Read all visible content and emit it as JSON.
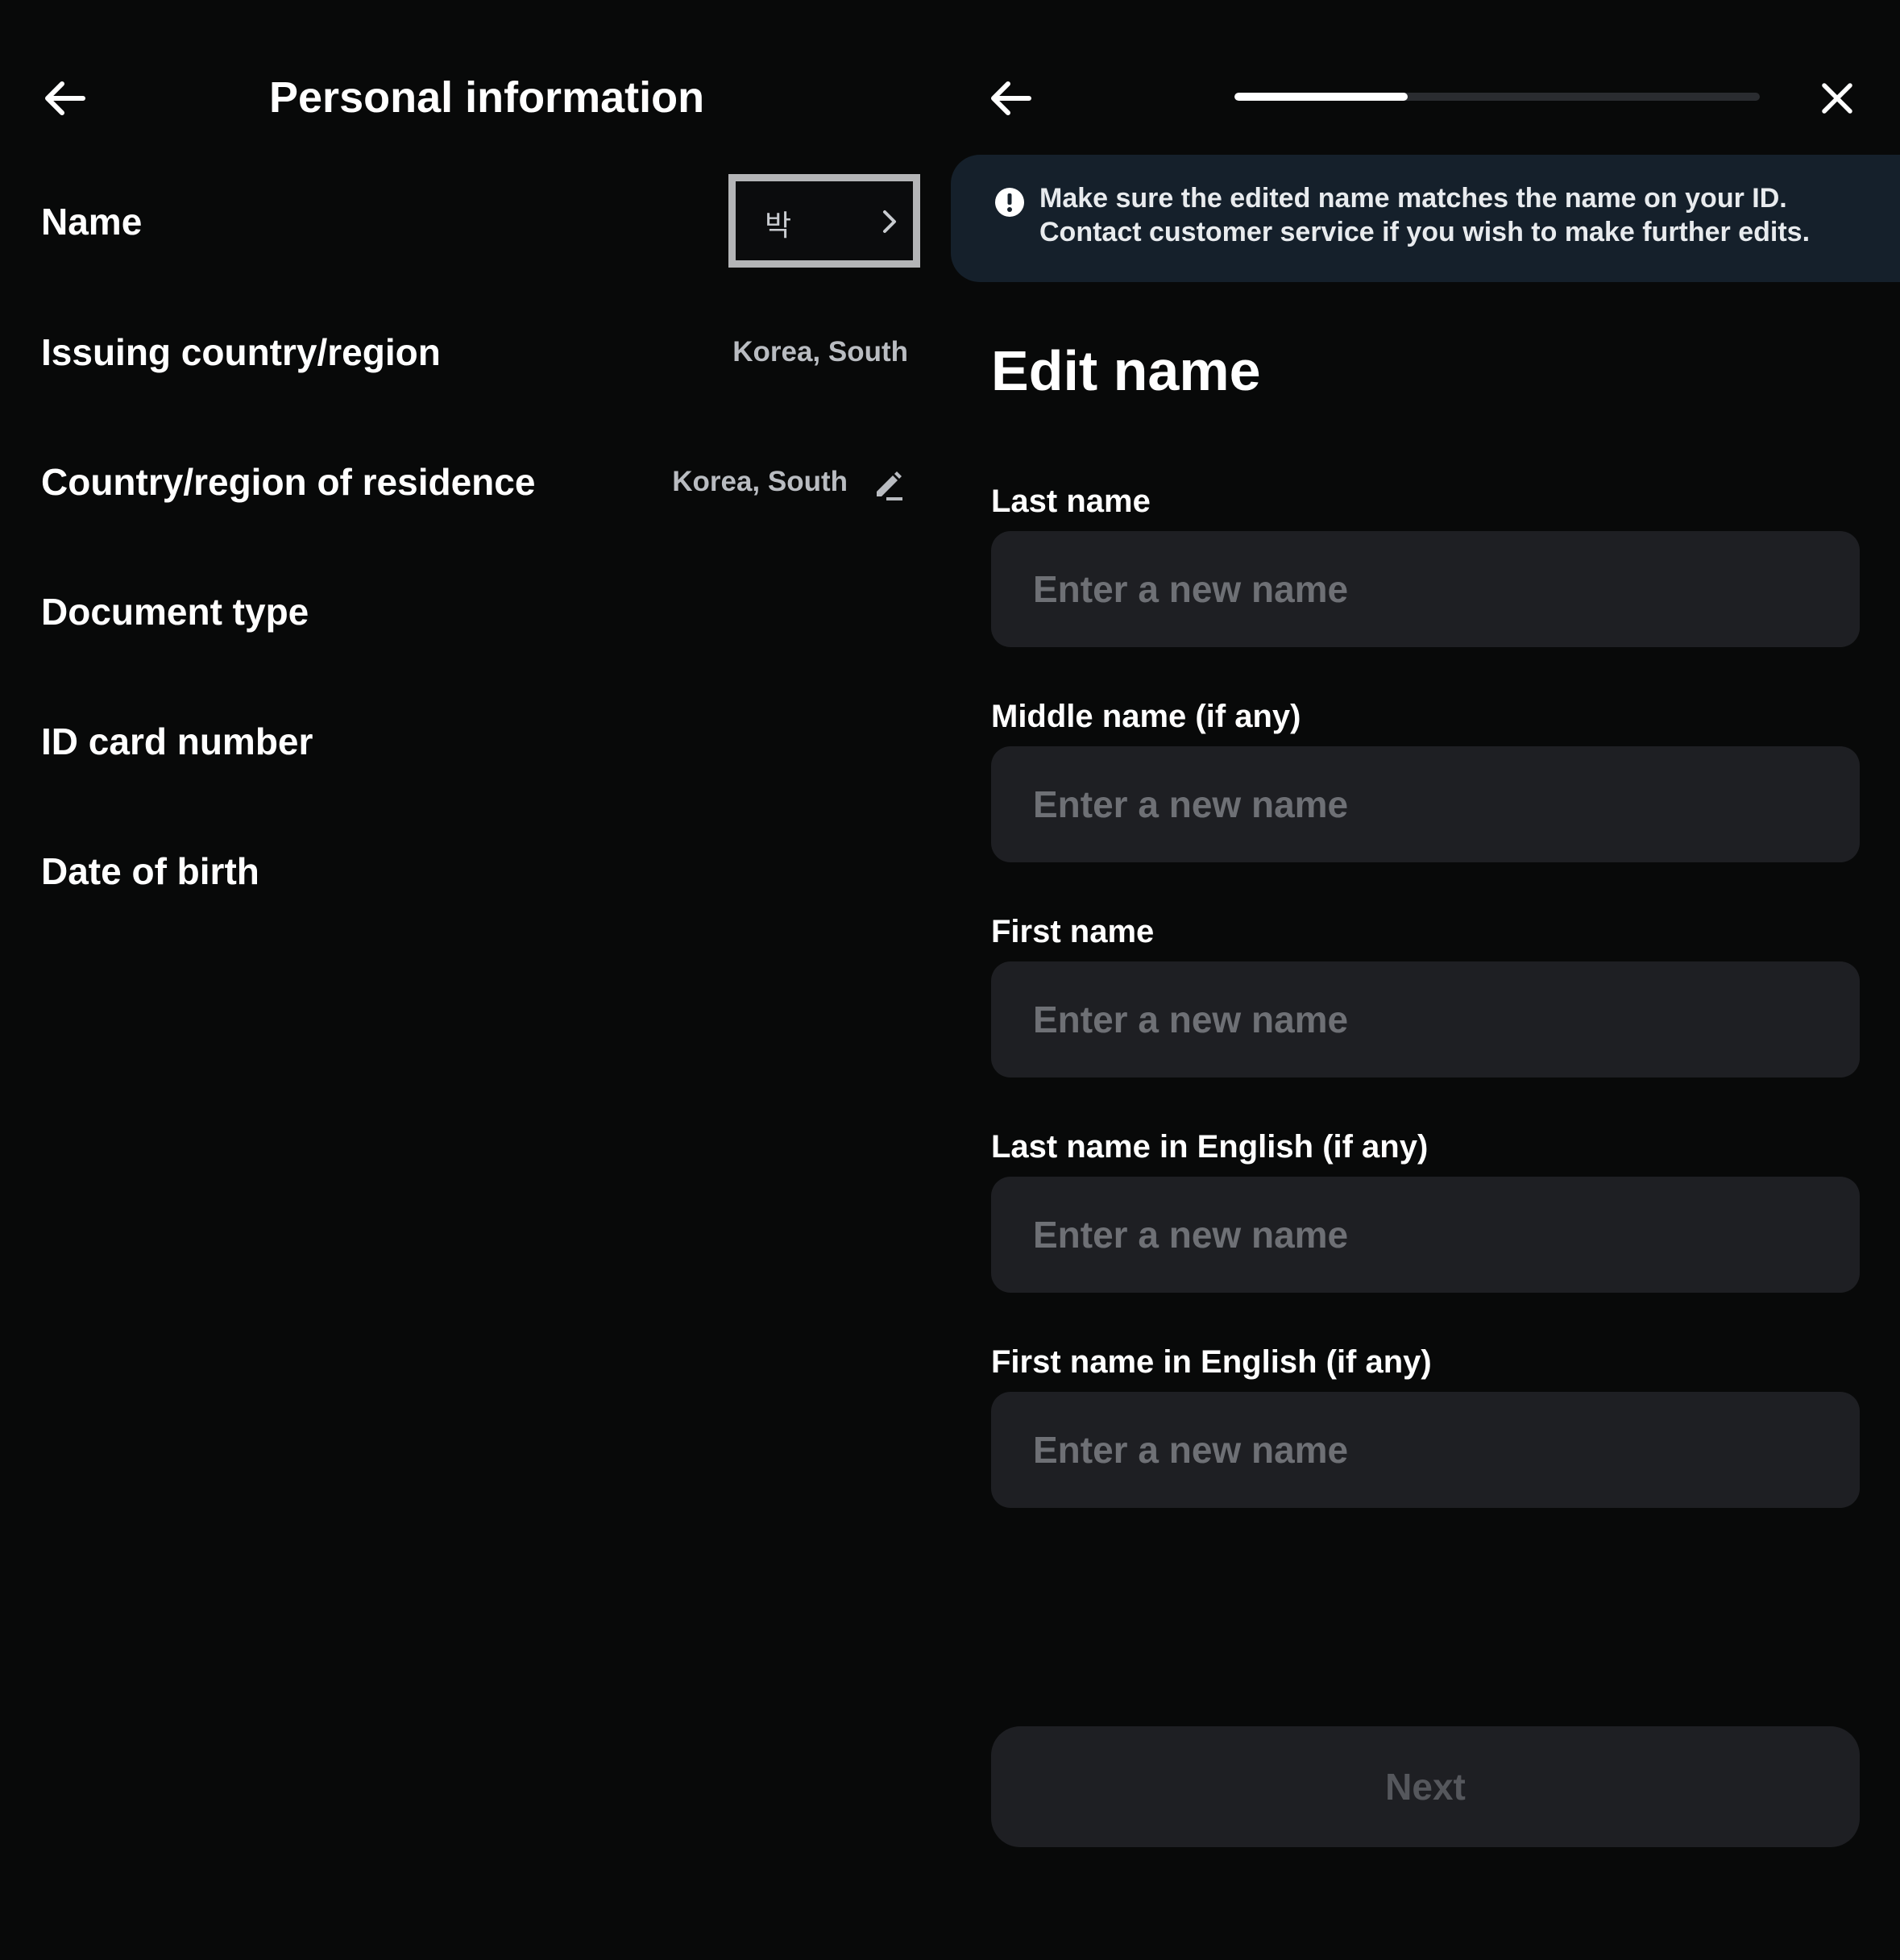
{
  "colors": {
    "background": "#080909",
    "notice_background": "#15202b",
    "input_background": "#1e1f23",
    "placeholder": "#6e7075",
    "secondary_text": "#b9bcc1",
    "progress_fill": "#ffffff",
    "progress_track": "#2a2c30",
    "button_disabled_text": "#55575c"
  },
  "personal_info": {
    "title": "Personal information",
    "back_icon": "arrow-left-icon",
    "rows": {
      "name": {
        "label": "Name",
        "value": "박",
        "icon": "chevron-right-icon"
      },
      "issuing_country": {
        "label": "Issuing country/region",
        "value": "Korea, South"
      },
      "residence": {
        "label": "Country/region of residence",
        "value": "Korea, South",
        "icon": "pencil-icon"
      },
      "document_type": {
        "label": "Document type"
      },
      "id_card_number": {
        "label": "ID card number"
      },
      "date_of_birth": {
        "label": "Date of birth"
      }
    }
  },
  "edit_name": {
    "back_icon": "arrow-left-icon",
    "close_icon": "close-icon",
    "progress": 0.33,
    "notice": {
      "icon": "exclamation-circle-icon",
      "line1": "Make sure the edited name matches the name on your ID.",
      "line2": "Contact customer service if you wish to make further edits."
    },
    "title": "Edit name",
    "fields": {
      "last_name": {
        "label": "Last name",
        "placeholder": "Enter a new name",
        "value": ""
      },
      "middle_name": {
        "label": "Middle name (if any)",
        "placeholder": "Enter a new name",
        "value": ""
      },
      "first_name": {
        "label": "First name",
        "placeholder": "Enter a new name",
        "value": ""
      },
      "last_name_en": {
        "label": "Last name in English (if any)",
        "placeholder": "Enter a new name",
        "value": ""
      },
      "first_name_en": {
        "label": "First name in English (if any)",
        "placeholder": "Enter a new name",
        "value": ""
      }
    },
    "next_label": "Next"
  }
}
